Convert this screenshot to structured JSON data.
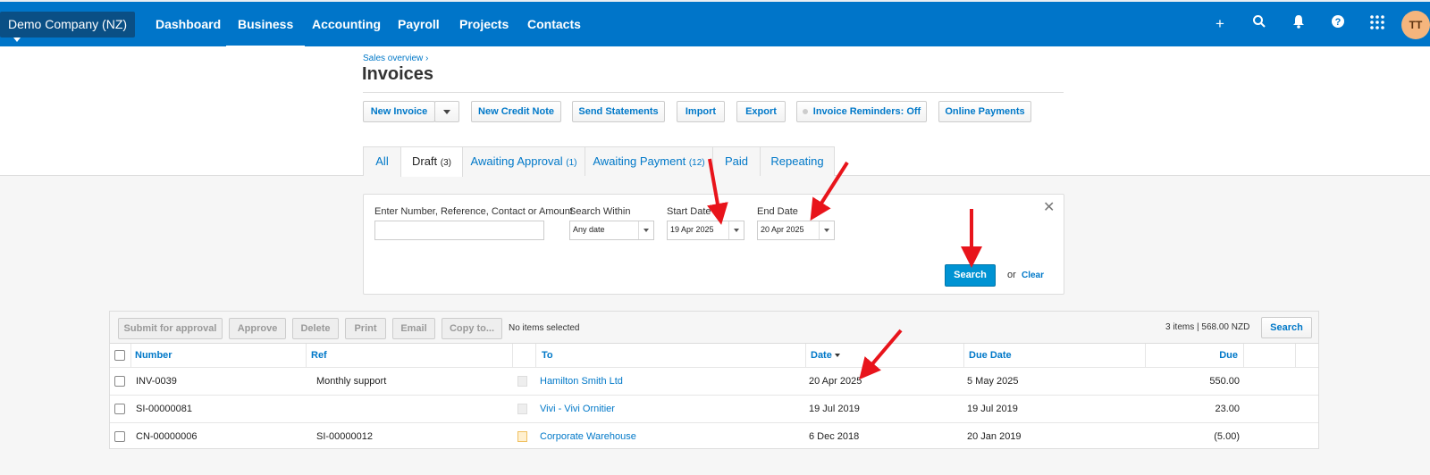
{
  "nav": {
    "org": "Demo Company (NZ)",
    "links": [
      "Dashboard",
      "Business",
      "Accounting",
      "Payroll",
      "Projects",
      "Contacts"
    ],
    "avatar": "TT"
  },
  "page": {
    "breadcrumb": "Sales overview ›",
    "title": "Invoices"
  },
  "actions": {
    "new_invoice": "New Invoice",
    "new_credit_note": "New Credit Note",
    "send_statements": "Send Statements",
    "import": "Import",
    "export": "Export",
    "reminders": "Invoice Reminders: Off",
    "online_payments": "Online Payments"
  },
  "tabs": [
    {
      "label": "All",
      "count": ""
    },
    {
      "label": "Draft",
      "count": "(3)"
    },
    {
      "label": "Awaiting Approval",
      "count": "(1)"
    },
    {
      "label": "Awaiting Payment",
      "count": "(12)"
    },
    {
      "label": "Paid",
      "count": ""
    },
    {
      "label": "Repeating",
      "count": ""
    }
  ],
  "search": {
    "query_label": "Enter Number, Reference, Contact or Amount",
    "query_value": "",
    "within_label": "Search Within",
    "within_value": "Any date",
    "start_label": "Start Date",
    "start_value": "19 Apr 2025",
    "end_label": "End Date",
    "end_value": "20 Apr 2025",
    "search_button": "Search",
    "or": "or",
    "clear": "Clear"
  },
  "list_toolbar": {
    "submit": "Submit for approval",
    "approve": "Approve",
    "delete": "Delete",
    "print": "Print",
    "email": "Email",
    "copy": "Copy to...",
    "selection": "No items selected",
    "summary": "3 items  | 568.00  NZD",
    "search": "Search"
  },
  "table": {
    "headers": {
      "number": "Number",
      "ref": "Ref",
      "to": "To",
      "date": "Date",
      "due_date": "Due Date",
      "due": "Due"
    },
    "rows": [
      {
        "number": "INV-0039",
        "ref": "Monthly support",
        "to": "Hamilton Smith Ltd",
        "date": "20 Apr 2025",
        "due_date": "5 May 2025",
        "due": "550.00"
      },
      {
        "number": "SI-00000081",
        "ref": "",
        "to": "Vivi - Vivi Ornitier",
        "date": "19 Jul 2019",
        "due_date": "19 Jul 2019",
        "due": "23.00"
      },
      {
        "number": "CN-00000006",
        "ref": "SI-00000012",
        "to": "Corporate Warehouse",
        "date": "6 Dec 2018",
        "due_date": "20 Jan 2019",
        "due": "(5.00)"
      }
    ]
  },
  "colors": {
    "nav_blue": "#0075c9",
    "link_blue": "#0078c8",
    "annotation_red": "#e8141b"
  }
}
